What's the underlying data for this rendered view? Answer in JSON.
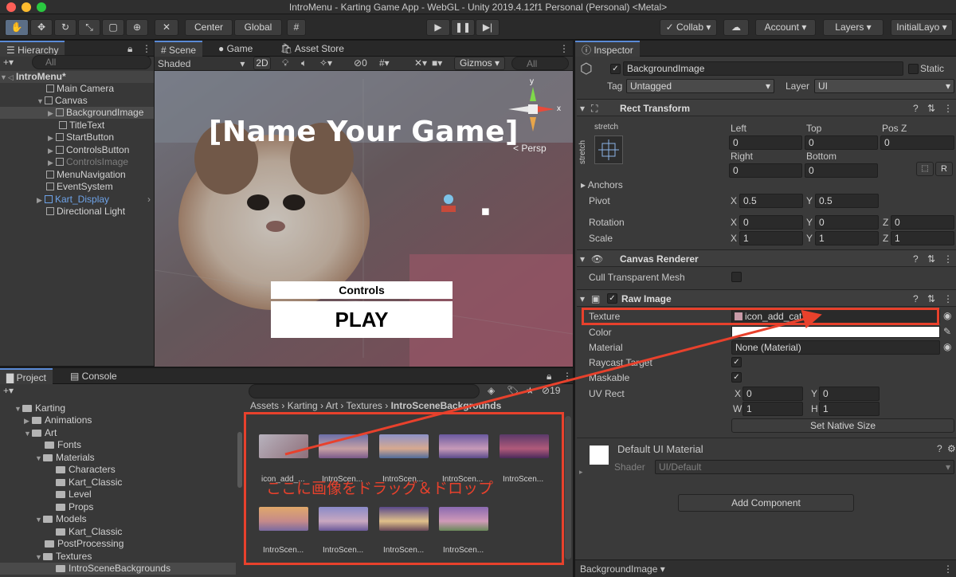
{
  "window": {
    "title": "IntroMenu - Karting Game App - WebGL - Unity 2019.4.12f1 Personal (Personal) <Metal>"
  },
  "toolbar": {
    "pivot": "Center",
    "space": "Global",
    "collab": "Collab",
    "account": "Account",
    "layers": "Layers",
    "layout": "InitialLayo"
  },
  "hierarchy": {
    "tab": "Hierarchy",
    "search_placeholder": "All",
    "items": [
      "IntroMenu*",
      "Main Camera",
      "Canvas",
      "BackgroundImage",
      "TitleText",
      "StartButton",
      "ControlsButton",
      "ControlsImage",
      "MenuNavigation",
      "EventSystem",
      "Kart_Display",
      "Directional Light"
    ]
  },
  "scene": {
    "tabs": [
      "Scene",
      "Game",
      "Asset Store"
    ],
    "shading": "Shaded",
    "mode2d": "2D",
    "hidden_count": "0",
    "gizmos": "Gizmos",
    "search_placeholder": "All",
    "title": "[Name Your Game]",
    "controls_label": "Controls",
    "play_label": "PLAY",
    "persp": "< Persp",
    "axes": {
      "y": "y",
      "x": "x"
    }
  },
  "project": {
    "tabs": [
      "Project",
      "Console"
    ],
    "count": "19",
    "breadcrumb": [
      "Assets",
      "Karting",
      "Art",
      "Textures",
      "IntroSceneBackgrounds"
    ],
    "tree": [
      "Karting",
      "Animations",
      "Art",
      "Fonts",
      "Materials",
      "Characters",
      "Kart_Classic",
      "Level",
      "Props",
      "Models",
      "Kart_Classic",
      "PostProcessing",
      "Textures",
      "IntroSceneBackgrounds"
    ],
    "assets": [
      "icon_add_...",
      "IntroScen...",
      "IntroScen...",
      "IntroScen...",
      "IntroScen...",
      "IntroScen...",
      "IntroScen...",
      "IntroScen...",
      "IntroScen..."
    ],
    "annotation": "ここに画像をドラッグ＆ドロップ"
  },
  "inspector": {
    "tab": "Inspector",
    "object_name": "BackgroundImage",
    "static_label": "Static",
    "tag_label": "Tag",
    "tag_value": "Untagged",
    "layer_label": "Layer",
    "layer_value": "UI",
    "rect": {
      "title": "Rect Transform",
      "stretch": "stretch",
      "left_label": "Left",
      "left": "0",
      "top_label": "Top",
      "top": "0",
      "posz_label": "Pos Z",
      "posz": "0",
      "right_label": "Right",
      "right": "0",
      "bottom_label": "Bottom",
      "bottom": "0",
      "r_button": "R",
      "anchors": "Anchors",
      "pivot_label": "Pivot",
      "pivot_x": "0.5",
      "pivot_y": "0.5",
      "rotation_label": "Rotation",
      "rot_x": "0",
      "rot_y": "0",
      "rot_z": "0",
      "scale_label": "Scale",
      "scale_x": "1",
      "scale_y": "1",
      "scale_z": "1"
    },
    "canvas_renderer": {
      "title": "Canvas Renderer",
      "cull_label": "Cull Transparent Mesh"
    },
    "raw_image": {
      "title": "Raw Image",
      "texture_label": "Texture",
      "texture_value": "icon_add_cat",
      "color_label": "Color",
      "material_label": "Material",
      "material_value": "None (Material)",
      "raycast_label": "Raycast Target",
      "maskable_label": "Maskable",
      "uvrect_label": "UV Rect",
      "uv_x": "0",
      "uv_y": "0",
      "uv_w": "1",
      "uv_h": "1",
      "native_size": "Set Native Size"
    },
    "material": {
      "title": "Default UI Material",
      "shader_label": "Shader",
      "shader_value": "UI/Default"
    },
    "add_component": "Add Component",
    "footer": "BackgroundImage"
  },
  "colors": {
    "highlight": "#e8412c",
    "selection": "#5a8ad6"
  }
}
